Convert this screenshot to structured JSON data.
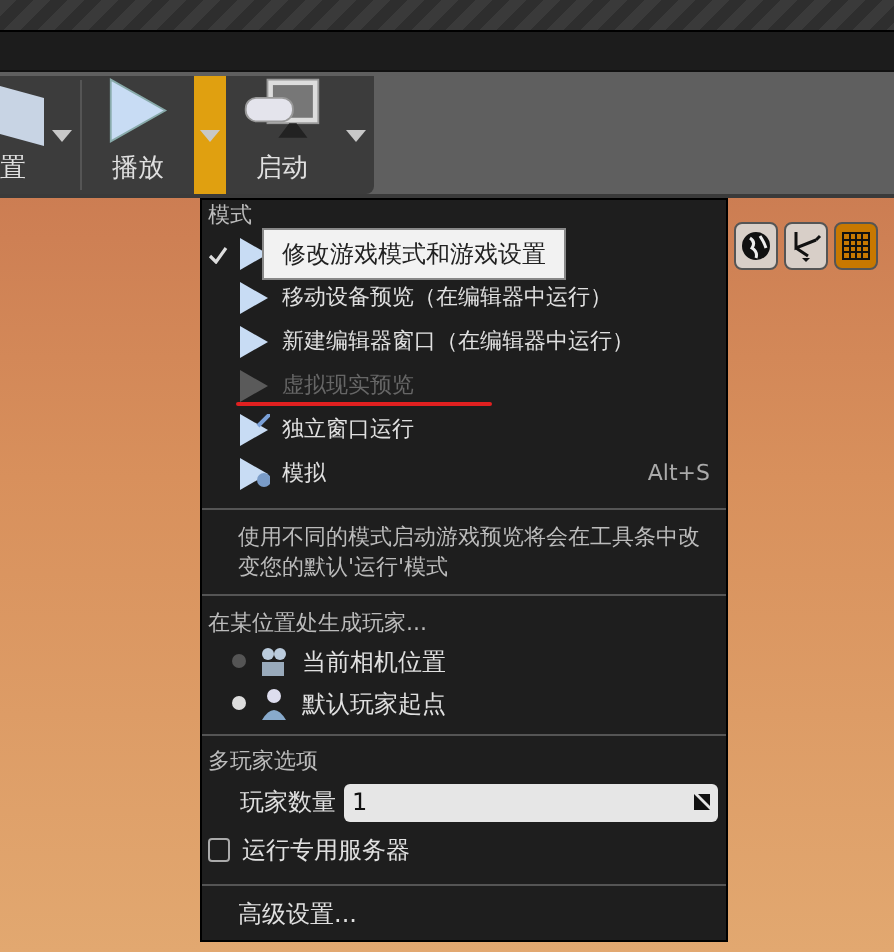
{
  "toolbar": {
    "buttons": [
      {
        "kind": "partial",
        "label": "置",
        "caret": true
      },
      {
        "kind": "play",
        "label": "播放",
        "caret": false
      },
      {
        "kind": "launch",
        "label": "启动",
        "caret": true
      }
    ],
    "dropdown_selected": true
  },
  "tooltip": "修改游戏模式和游戏设置",
  "menu": {
    "mode_header": "模式",
    "modes": [
      {
        "checked": true,
        "disabled": false
      },
      {
        "label": "移动设备预览（在编辑器中运行）",
        "checked": false,
        "disabled": false
      },
      {
        "label": "新建编辑器窗口（在编辑器中运行）",
        "checked": false,
        "disabled": false
      },
      {
        "label": "虚拟现实预览",
        "checked": false,
        "disabled": true,
        "underlined": true
      },
      {
        "label": "独立窗口运行",
        "checked": false,
        "disabled": false
      },
      {
        "label": "模拟",
        "shortcut": "Alt+S",
        "checked": false,
        "disabled": false
      }
    ],
    "description": "使用不同的模式启动游戏预览将会在工具条中改变您的默认'运行'模式",
    "spawn_header": "在某位置处生成玩家...",
    "spawn": [
      {
        "label": "当前相机位置",
        "selected": false
      },
      {
        "label": "默认玩家起点",
        "selected": true
      }
    ],
    "multiplayer_header": "多玩家选项",
    "players": {
      "label": "玩家数量",
      "value": "1"
    },
    "dedicated_server": {
      "label": "运行专用服务器",
      "checked": false
    },
    "advanced": "高级设置..."
  },
  "viewport_tools": [
    {
      "kind": "globe",
      "selected": false
    },
    {
      "kind": "transform",
      "selected": false
    },
    {
      "kind": "grid",
      "selected": true
    }
  ]
}
